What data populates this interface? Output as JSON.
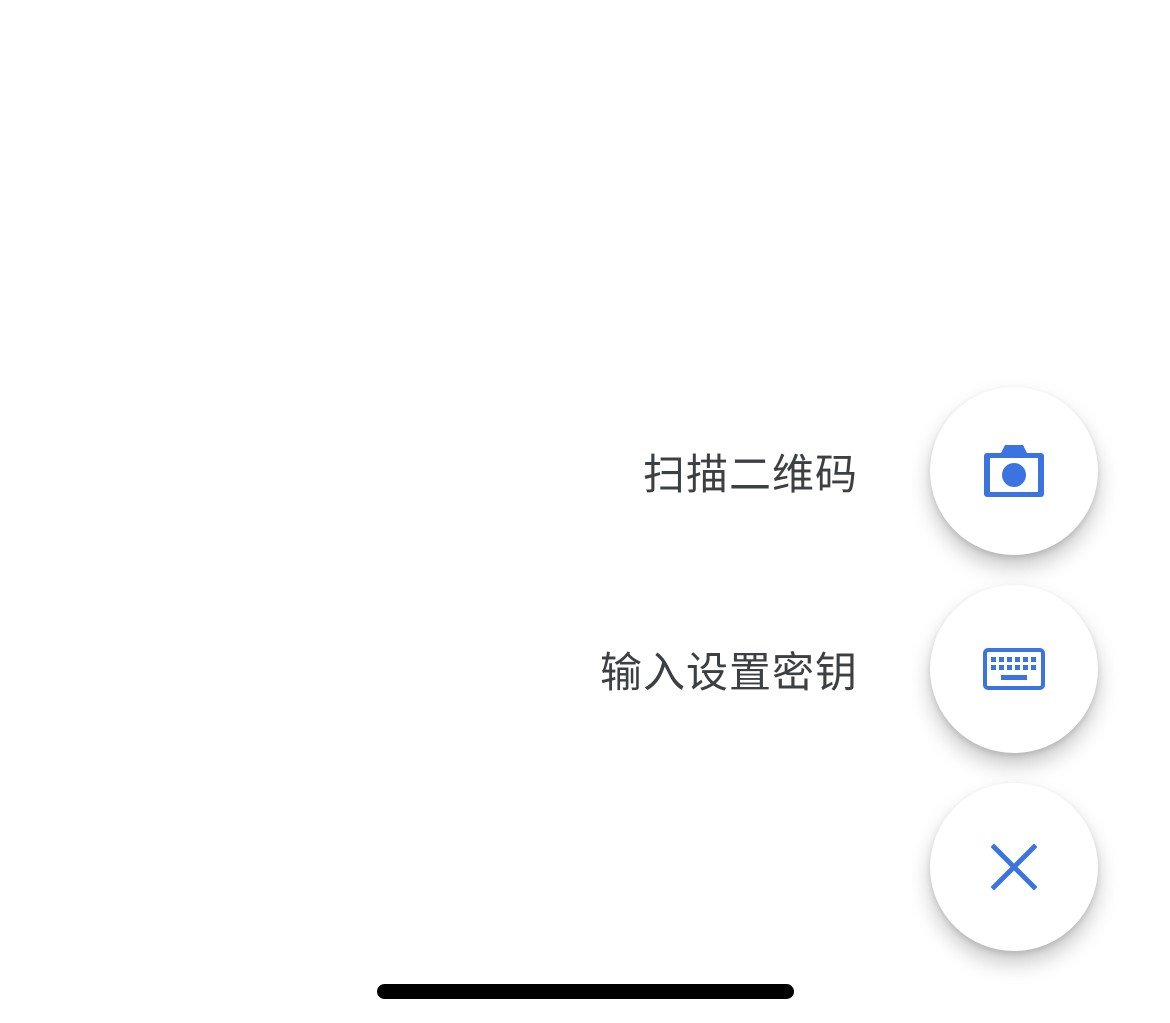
{
  "speed_dial": {
    "scan": {
      "label": "扫描二维码",
      "icon": "camera-icon"
    },
    "enter_key": {
      "label": "输入设置密钥",
      "icon": "keyboard-icon"
    },
    "close": {
      "icon": "close-icon"
    }
  },
  "colors": {
    "accent": "#3b74e0",
    "label_text": "#3c4043",
    "fab_background": "#ffffff",
    "home_indicator": "#000000"
  }
}
